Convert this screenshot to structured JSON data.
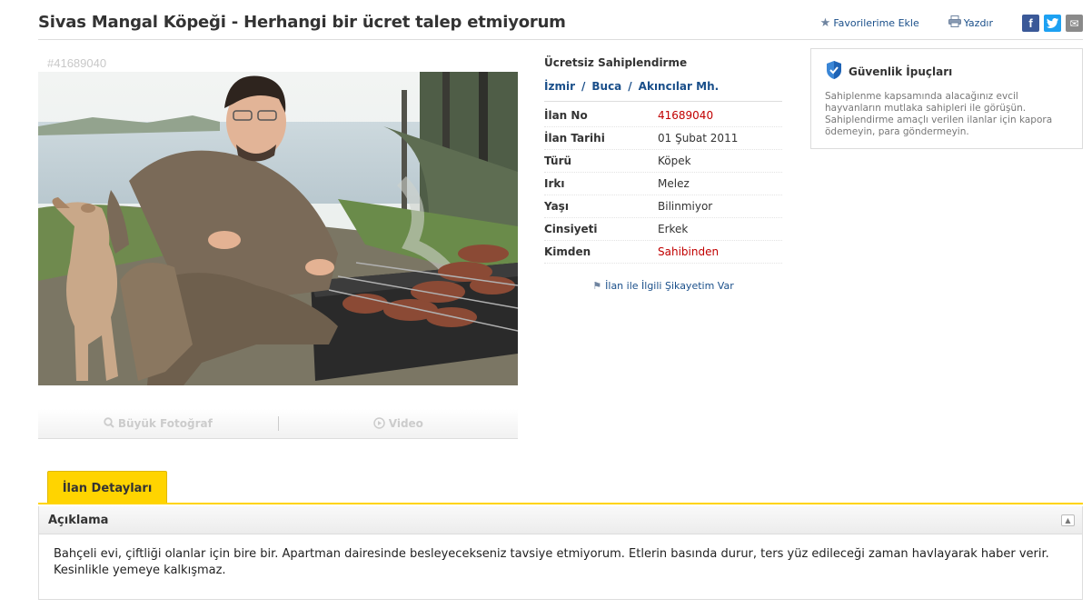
{
  "listing": {
    "title": "Sivas Mangal Köpeği - Herhangi bir ücret talep etmiyorum"
  },
  "actions": {
    "favorite_label": "Favorilerime Ekle",
    "print_label": "Yazdır"
  },
  "social": {
    "facebook": "f",
    "twitter": "t",
    "mail": "✉"
  },
  "photo": {
    "id_text": "#41689040"
  },
  "media": {
    "big_photo_label": "Büyük Fotoğraf",
    "video_label": "Video"
  },
  "info": {
    "category": "Ücretsiz Sahiplendirme",
    "location": [
      "İzmir",
      "Buca",
      "Akıncılar Mh."
    ],
    "rows": [
      {
        "key": "İlan No",
        "value": "41689040",
        "highlight": true
      },
      {
        "key": "İlan Tarihi",
        "value": "01 Şubat 2011",
        "highlight": false
      },
      {
        "key": "Türü",
        "value": "Köpek",
        "highlight": false
      },
      {
        "key": "Irkı",
        "value": "Melez",
        "highlight": false
      },
      {
        "key": "Yaşı",
        "value": "Bilinmiyor",
        "highlight": false
      },
      {
        "key": "Cinsiyeti",
        "value": "Erkek",
        "highlight": false
      },
      {
        "key": "Kimden",
        "value": "Sahibinden",
        "highlight": true
      }
    ],
    "complaint_label": "İlan ile İlgili Şikayetim Var"
  },
  "tips": {
    "title": "Güvenlik İpuçları",
    "text": "Sahiplenme kapsamında alacağınız evcil hayvanların mutlaka sahipleri ile görüşün. Sahiplendirme amaçlı verilen ilanlar için kapora ödemeyin, para göndermeyin."
  },
  "details": {
    "tab_label": "İlan Detayları",
    "section_title": "Açıklama",
    "description": "Bahçeli evi, çiftliği olanlar için bire bir. Apartman dairesinde besleyecekseniz tavsiye etmiyorum. Etlerin basında durur, ters yüz edileceği zaman havlayarak haber verir. Kesinlikle yemeye kalkışmaz."
  },
  "colors": {
    "accent_yellow": "#ffd400",
    "link_blue": "#1a4f8a",
    "value_red": "#c10000"
  }
}
